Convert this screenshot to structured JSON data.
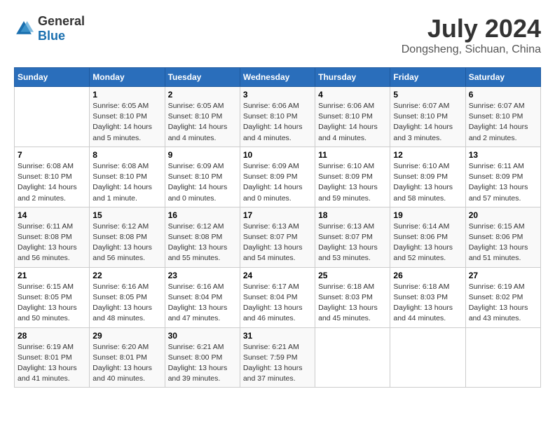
{
  "logo": {
    "general": "General",
    "blue": "Blue"
  },
  "title": "July 2024",
  "subtitle": "Dongsheng, Sichuan, China",
  "days_header": [
    "Sunday",
    "Monday",
    "Tuesday",
    "Wednesday",
    "Thursday",
    "Friday",
    "Saturday"
  ],
  "weeks": [
    [
      {
        "num": "",
        "info": ""
      },
      {
        "num": "1",
        "info": "Sunrise: 6:05 AM\nSunset: 8:10 PM\nDaylight: 14 hours\nand 5 minutes."
      },
      {
        "num": "2",
        "info": "Sunrise: 6:05 AM\nSunset: 8:10 PM\nDaylight: 14 hours\nand 4 minutes."
      },
      {
        "num": "3",
        "info": "Sunrise: 6:06 AM\nSunset: 8:10 PM\nDaylight: 14 hours\nand 4 minutes."
      },
      {
        "num": "4",
        "info": "Sunrise: 6:06 AM\nSunset: 8:10 PM\nDaylight: 14 hours\nand 4 minutes."
      },
      {
        "num": "5",
        "info": "Sunrise: 6:07 AM\nSunset: 8:10 PM\nDaylight: 14 hours\nand 3 minutes."
      },
      {
        "num": "6",
        "info": "Sunrise: 6:07 AM\nSunset: 8:10 PM\nDaylight: 14 hours\nand 2 minutes."
      }
    ],
    [
      {
        "num": "7",
        "info": "Sunrise: 6:08 AM\nSunset: 8:10 PM\nDaylight: 14 hours\nand 2 minutes."
      },
      {
        "num": "8",
        "info": "Sunrise: 6:08 AM\nSunset: 8:10 PM\nDaylight: 14 hours\nand 1 minute."
      },
      {
        "num": "9",
        "info": "Sunrise: 6:09 AM\nSunset: 8:10 PM\nDaylight: 14 hours\nand 0 minutes."
      },
      {
        "num": "10",
        "info": "Sunrise: 6:09 AM\nSunset: 8:09 PM\nDaylight: 14 hours\nand 0 minutes."
      },
      {
        "num": "11",
        "info": "Sunrise: 6:10 AM\nSunset: 8:09 PM\nDaylight: 13 hours\nand 59 minutes."
      },
      {
        "num": "12",
        "info": "Sunrise: 6:10 AM\nSunset: 8:09 PM\nDaylight: 13 hours\nand 58 minutes."
      },
      {
        "num": "13",
        "info": "Sunrise: 6:11 AM\nSunset: 8:09 PM\nDaylight: 13 hours\nand 57 minutes."
      }
    ],
    [
      {
        "num": "14",
        "info": "Sunrise: 6:11 AM\nSunset: 8:08 PM\nDaylight: 13 hours\nand 56 minutes."
      },
      {
        "num": "15",
        "info": "Sunrise: 6:12 AM\nSunset: 8:08 PM\nDaylight: 13 hours\nand 56 minutes."
      },
      {
        "num": "16",
        "info": "Sunrise: 6:12 AM\nSunset: 8:08 PM\nDaylight: 13 hours\nand 55 minutes."
      },
      {
        "num": "17",
        "info": "Sunrise: 6:13 AM\nSunset: 8:07 PM\nDaylight: 13 hours\nand 54 minutes."
      },
      {
        "num": "18",
        "info": "Sunrise: 6:13 AM\nSunset: 8:07 PM\nDaylight: 13 hours\nand 53 minutes."
      },
      {
        "num": "19",
        "info": "Sunrise: 6:14 AM\nSunset: 8:06 PM\nDaylight: 13 hours\nand 52 minutes."
      },
      {
        "num": "20",
        "info": "Sunrise: 6:15 AM\nSunset: 8:06 PM\nDaylight: 13 hours\nand 51 minutes."
      }
    ],
    [
      {
        "num": "21",
        "info": "Sunrise: 6:15 AM\nSunset: 8:05 PM\nDaylight: 13 hours\nand 50 minutes."
      },
      {
        "num": "22",
        "info": "Sunrise: 6:16 AM\nSunset: 8:05 PM\nDaylight: 13 hours\nand 48 minutes."
      },
      {
        "num": "23",
        "info": "Sunrise: 6:16 AM\nSunset: 8:04 PM\nDaylight: 13 hours\nand 47 minutes."
      },
      {
        "num": "24",
        "info": "Sunrise: 6:17 AM\nSunset: 8:04 PM\nDaylight: 13 hours\nand 46 minutes."
      },
      {
        "num": "25",
        "info": "Sunrise: 6:18 AM\nSunset: 8:03 PM\nDaylight: 13 hours\nand 45 minutes."
      },
      {
        "num": "26",
        "info": "Sunrise: 6:18 AM\nSunset: 8:03 PM\nDaylight: 13 hours\nand 44 minutes."
      },
      {
        "num": "27",
        "info": "Sunrise: 6:19 AM\nSunset: 8:02 PM\nDaylight: 13 hours\nand 43 minutes."
      }
    ],
    [
      {
        "num": "28",
        "info": "Sunrise: 6:19 AM\nSunset: 8:01 PM\nDaylight: 13 hours\nand 41 minutes."
      },
      {
        "num": "29",
        "info": "Sunrise: 6:20 AM\nSunset: 8:01 PM\nDaylight: 13 hours\nand 40 minutes."
      },
      {
        "num": "30",
        "info": "Sunrise: 6:21 AM\nSunset: 8:00 PM\nDaylight: 13 hours\nand 39 minutes."
      },
      {
        "num": "31",
        "info": "Sunrise: 6:21 AM\nSunset: 7:59 PM\nDaylight: 13 hours\nand 37 minutes."
      },
      {
        "num": "",
        "info": ""
      },
      {
        "num": "",
        "info": ""
      },
      {
        "num": "",
        "info": ""
      }
    ]
  ]
}
